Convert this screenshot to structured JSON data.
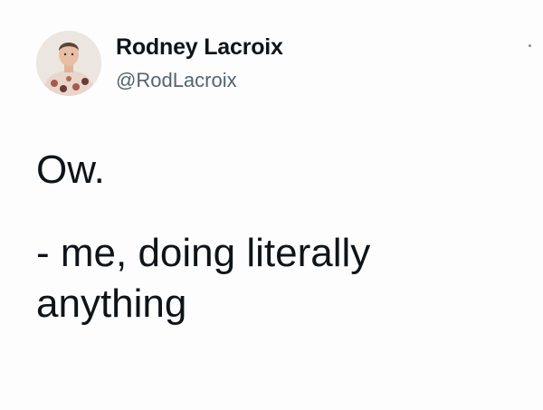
{
  "author": {
    "display_name": "Rodney Lacroix",
    "handle": "@RodLacroix",
    "avatar_icon": "profile-photo"
  },
  "tweet": {
    "paragraphs": [
      "Ow.",
      "- me, doing literally anything"
    ]
  },
  "menu": {
    "icon": "more-options-icon"
  },
  "colors": {
    "text": "#0f1419",
    "handle": "#536471",
    "background": "#fdfdfd"
  }
}
